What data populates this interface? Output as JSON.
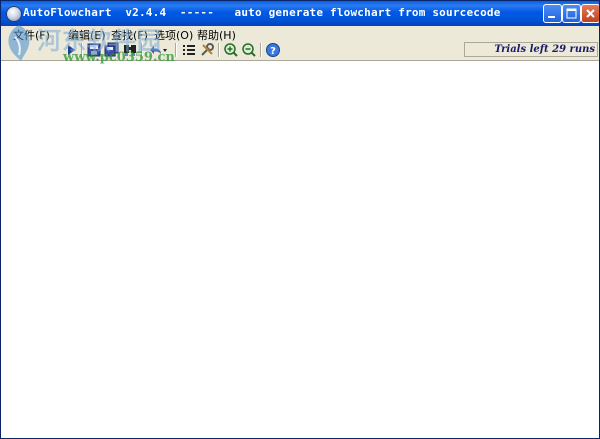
{
  "window": {
    "title": "AutoFlowchart  v2.4.4  -----   auto generate flowchart from sourcecode"
  },
  "menu": {
    "items": [
      {
        "label": "文件(F)"
      },
      {
        "label": "编辑(E)"
      },
      {
        "label": "查找(F)"
      },
      {
        "label": "选项(O)"
      },
      {
        "label": "帮助(H)"
      }
    ]
  },
  "toolbar": {
    "buttons": [
      {
        "icon": "run-icon"
      },
      {
        "icon": "save-icon"
      },
      {
        "icon": "save-all-icon"
      },
      {
        "icon": "find-icon"
      },
      {
        "icon": "undo-icon"
      },
      {
        "icon": "list-icon"
      },
      {
        "icon": "tools-icon"
      },
      {
        "icon": "zoom-in-icon"
      },
      {
        "icon": "zoom-out-icon"
      },
      {
        "icon": "help-icon"
      }
    ],
    "status": "Trials left 29 runs"
  },
  "watermark": {
    "text": "河东软件园",
    "url": "www.pc0359.cn"
  },
  "colors": {
    "titlebar": "#0054d8",
    "face": "#ece9d8",
    "canvas": "#ffffff",
    "status_text": "#1a1a6a"
  }
}
